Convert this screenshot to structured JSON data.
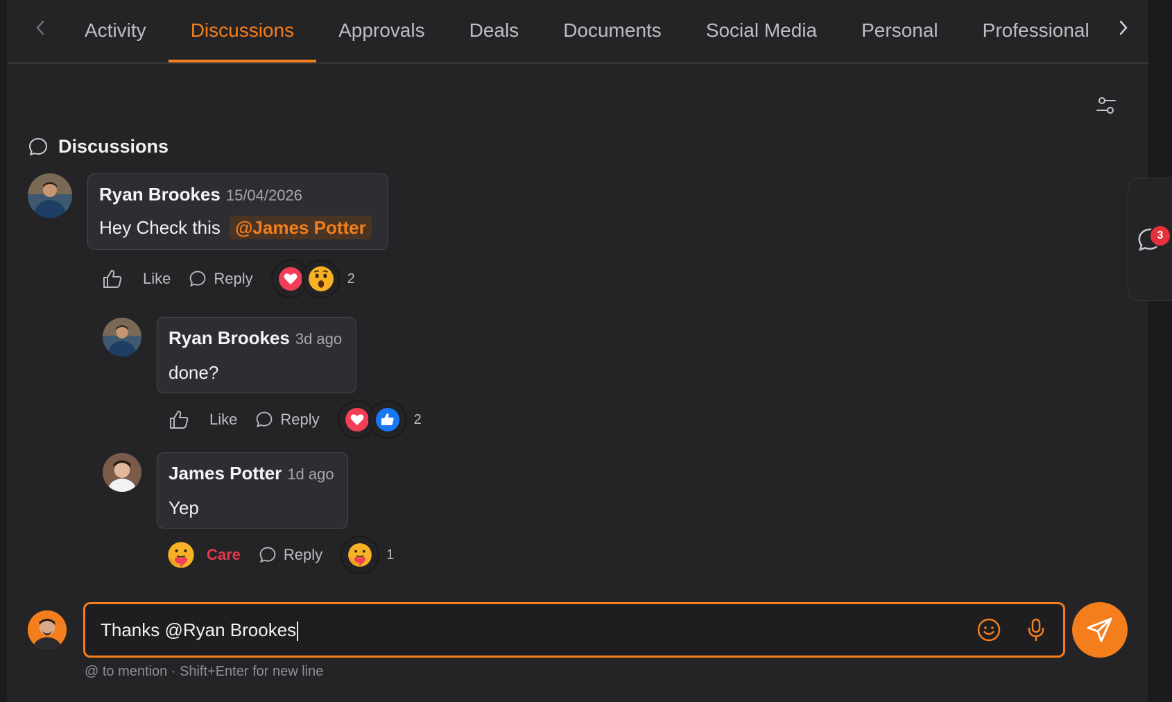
{
  "tabs": [
    {
      "label": "Activity",
      "active": false
    },
    {
      "label": "Discussions",
      "active": true
    },
    {
      "label": "Approvals",
      "active": false
    },
    {
      "label": "Deals",
      "active": false
    },
    {
      "label": "Documents",
      "active": false
    },
    {
      "label": "Social Media",
      "active": false
    },
    {
      "label": "Personal",
      "active": false
    },
    {
      "label": "Professional",
      "active": false
    }
  ],
  "section": {
    "title": "Discussions"
  },
  "comments": [
    {
      "author": "Ryan Brookes",
      "time": "15/04/2026",
      "text": "Hey Check this",
      "mention": "@James Potter",
      "like_label": "Like",
      "reply_label": "Reply",
      "reactions": [
        "heart",
        "wow"
      ],
      "reaction_count": "2"
    },
    {
      "author": "Ryan Brookes",
      "time": "3d ago",
      "text": "done?",
      "like_label": "Like",
      "reply_label": "Reply",
      "reactions": [
        "heart",
        "like"
      ],
      "reaction_count": "2"
    },
    {
      "author": "James Potter",
      "time": "1d ago",
      "text": "Yep",
      "like_label": "Care",
      "reply_label": "Reply",
      "reactions": [
        "care"
      ],
      "reaction_count": "1"
    }
  ],
  "composer": {
    "value": "Thanks @Ryan Brookes",
    "hint": "@ to mention · Shift+Enter for new line"
  },
  "side_panel": {
    "badge": "3"
  },
  "colors": {
    "accent": "#f47e1c",
    "background": "#242427",
    "bubble": "#2e2e32",
    "badge": "#e5313b",
    "care_label": "#e5394a"
  }
}
